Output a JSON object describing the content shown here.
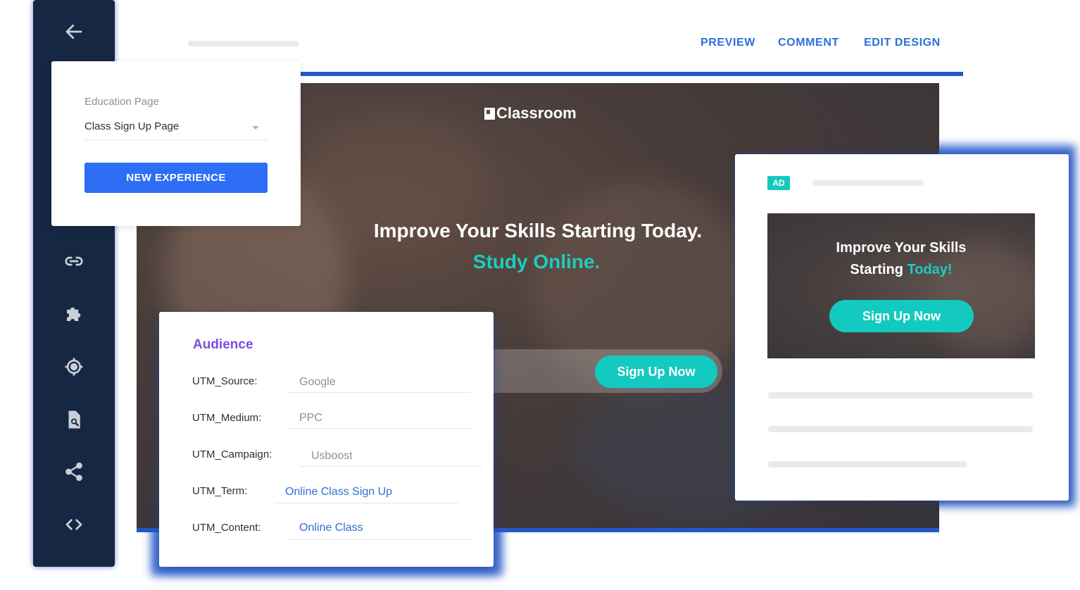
{
  "toolbar": {
    "preview": "PREVIEW",
    "comment": "COMMENT",
    "edit_design": "EDIT DESIGN"
  },
  "sidebar": {
    "icons": [
      "back-arrow-icon",
      "link-icon",
      "puzzle-icon",
      "target-icon",
      "page-search-icon",
      "share-icon",
      "code-icon"
    ]
  },
  "experience_panel": {
    "label": "Education Page",
    "selected_page": "Class Sign Up Page",
    "button": "NEW EXPERIENCE"
  },
  "hero": {
    "brand": "Classroom",
    "headline": "Improve Your Skills Starting Today.",
    "subheadline": "Study Online.",
    "cta": "Sign Up Now"
  },
  "audience": {
    "title": "Audience",
    "fields": [
      {
        "key": "UTM_Source:",
        "value": "Google"
      },
      {
        "key": "UTM_Medium:",
        "value": "PPC"
      },
      {
        "key": "UTM_Campaign:",
        "value": "Usboost"
      },
      {
        "key": "UTM_Term:",
        "value": "Online Class Sign Up"
      },
      {
        "key": "UTM_Content:",
        "value": "Online Class"
      }
    ]
  },
  "ad": {
    "badge": "AD",
    "line1": "Improve Your Skills",
    "line2_prefix": "Starting ",
    "line2_accent": "Today!",
    "cta": "Sign Up Now"
  },
  "colors": {
    "accent_blue": "#2458c7",
    "teal": "#14c9c0",
    "purple": "#7b4fe0",
    "sidebar": "#152742"
  }
}
